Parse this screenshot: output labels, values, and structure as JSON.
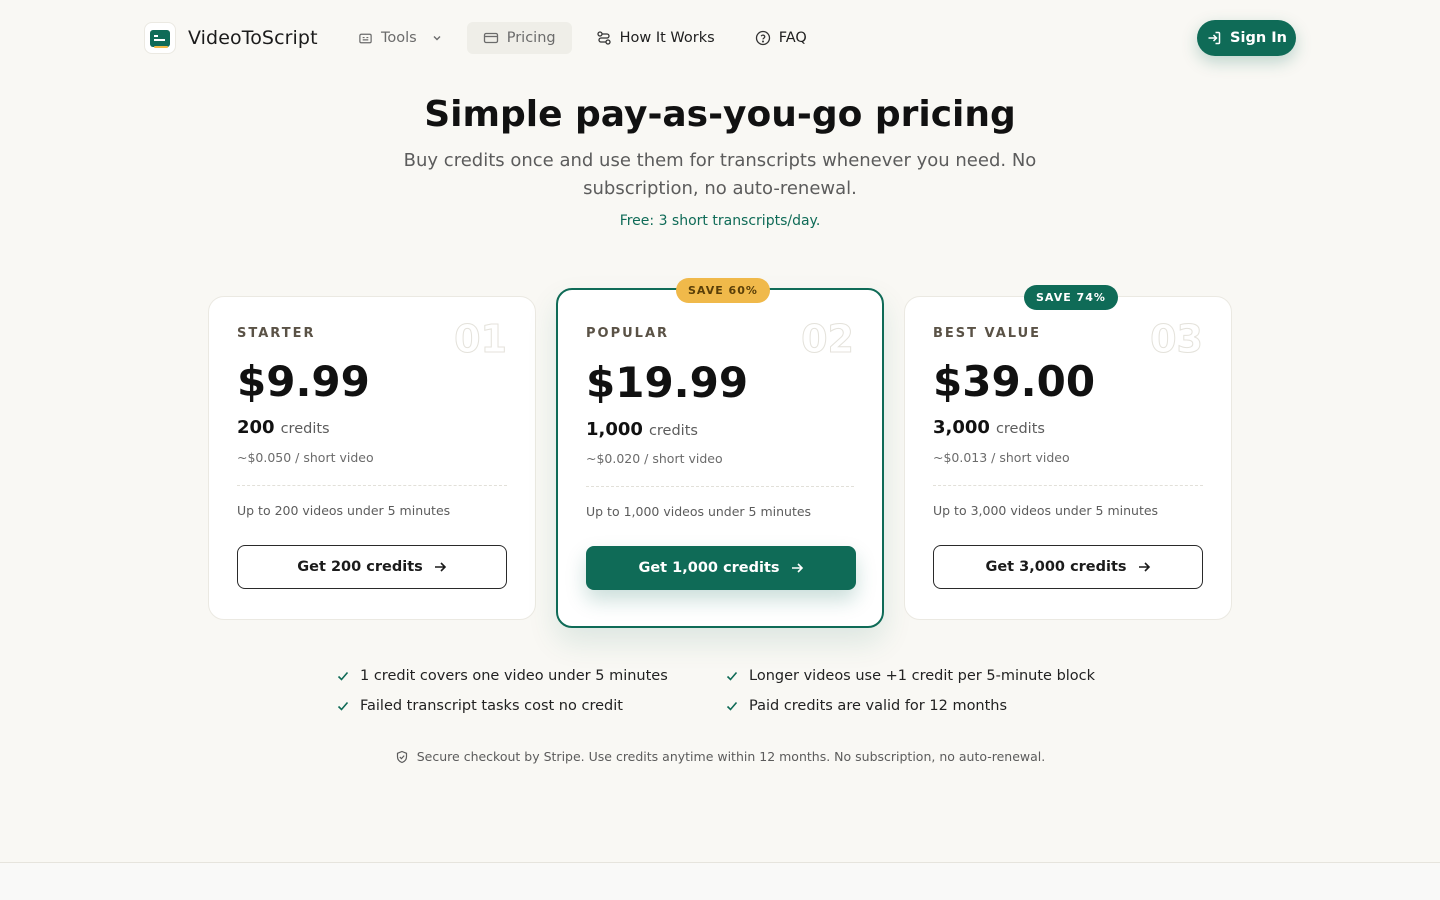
{
  "brand": {
    "name": "VideoToScript"
  },
  "nav": {
    "tools": "Tools",
    "pricing": "Pricing",
    "how_it_works": "How It Works",
    "faq": "FAQ"
  },
  "signin": "Sign In",
  "hero": {
    "title": "Simple pay-as-you-go pricing",
    "subtitle": "Buy credits once and use them for transcripts whenever you need. No subscription, no auto-renewal.",
    "free": "Free: 3 short transcripts/day."
  },
  "plans": [
    {
      "tier": "STARTER",
      "num": "01",
      "price": "$9.99",
      "credits": "200",
      "credits_label": "credits",
      "per": "~$0.050 / short video",
      "feature": "Up to 200 videos under 5 minutes",
      "cta": "Get 200 credits"
    },
    {
      "tier": "POPULAR",
      "num": "02",
      "price": "$19.99",
      "credits": "1,000",
      "credits_label": "credits",
      "per": "~$0.020 / short video",
      "feature": "Up to 1,000 videos under 5 minutes",
      "cta": "Get 1,000 credits",
      "badge": "SAVE 60%"
    },
    {
      "tier": "BEST VALUE",
      "num": "03",
      "price": "$39.00",
      "credits": "3,000",
      "credits_label": "credits",
      "per": "~$0.013 / short video",
      "feature": "Up to 3,000 videos under 5 minutes",
      "cta": "Get 3,000 credits",
      "badge": "SAVE 74%"
    }
  ],
  "notes": [
    "1 credit covers one video under 5 minutes",
    "Longer videos use +1 credit per 5-minute block",
    "Failed transcript tasks cost no credit",
    "Paid credits are valid for 12 months"
  ],
  "secure": "Secure checkout by Stripe. Use credits anytime within 12 months. No subscription, no auto-renewal.",
  "colors": {
    "accent": "#0f6b57",
    "highlight": "#f0b94a",
    "background": "#f9f8f4"
  }
}
